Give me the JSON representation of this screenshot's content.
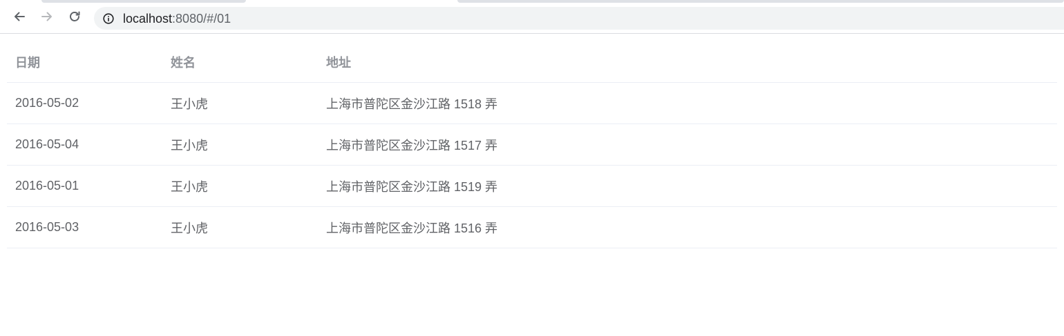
{
  "browser": {
    "url_host": "localhost",
    "url_rest": ":8080/#/01",
    "icons": {
      "back": "arrow-left-icon",
      "forward": "arrow-right-icon",
      "reload": "reload-icon",
      "site_info": "info-circle-icon"
    }
  },
  "table": {
    "columns": [
      "日期",
      "姓名",
      "地址"
    ],
    "rows": [
      {
        "date": "2016-05-02",
        "name": "王小虎",
        "address": "上海市普陀区金沙江路 1518 弄"
      },
      {
        "date": "2016-05-04",
        "name": "王小虎",
        "address": "上海市普陀区金沙江路 1517 弄"
      },
      {
        "date": "2016-05-01",
        "name": "王小虎",
        "address": "上海市普陀区金沙江路 1519 弄"
      },
      {
        "date": "2016-05-03",
        "name": "王小虎",
        "address": "上海市普陀区金沙江路 1516 弄"
      }
    ]
  },
  "colors": {
    "header_text": "#909399",
    "cell_text": "#606266",
    "row_border": "#ebeef5",
    "omnibox_bg": "#f1f3f4"
  }
}
